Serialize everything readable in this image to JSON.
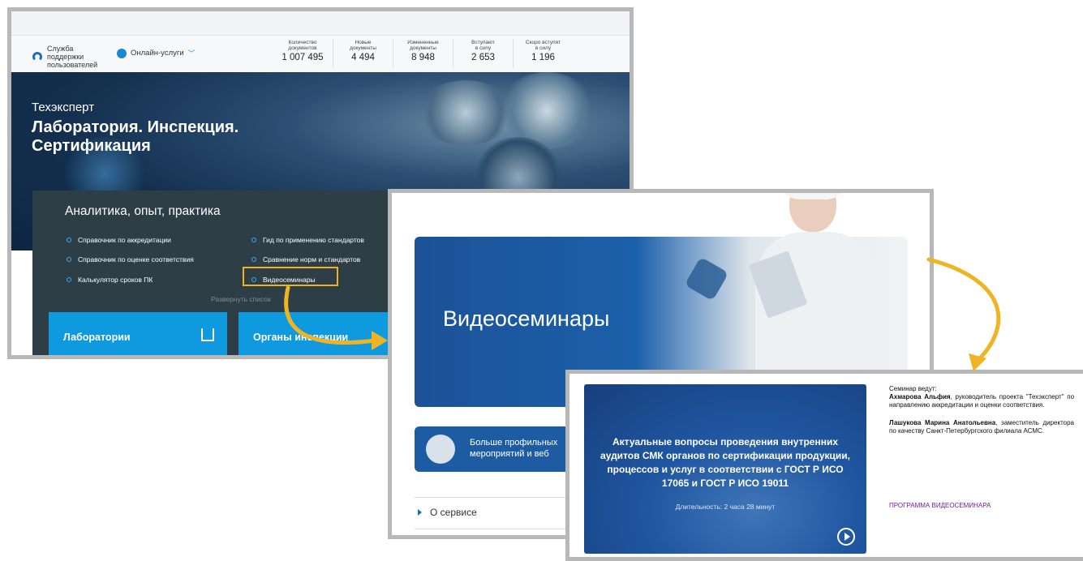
{
  "site": {
    "support_label": "Служба поддержки пользователей",
    "online_label": "Онлайн-услуги",
    "stats": [
      {
        "label": "Количество\nдокументов",
        "value": "1 007 495"
      },
      {
        "label": "Новые\nдокументы",
        "value": "4 494"
      },
      {
        "label": "Измененные\nдокументы",
        "value": "8 948"
      },
      {
        "label": "Вступают\nв силу",
        "value": "2 653"
      },
      {
        "label": "Скоро вступят\nв силу",
        "value": "1 196"
      }
    ],
    "hero": {
      "subtitle": "Техэксперт",
      "title": "Лаборатория. Инспекция. Сертификация"
    },
    "analytics": {
      "title": "Аналитика, опыт, практика",
      "links_left": [
        "Справочник по аккредитации",
        "Справочник по оценке соответствия",
        "Калькулятор сроков ПК"
      ],
      "links_right": [
        "Гид по применению стандартов",
        "Сравнение норм и стандартов",
        "Видеосеминары"
      ],
      "expand_label": "Развернуть список"
    },
    "cards": {
      "lab": "Лаборатории",
      "inspection": "Органы инспекции"
    }
  },
  "videos_page": {
    "banner_title": "Видеосеминары",
    "promo_line1": "Больше профильных",
    "promo_line2": "мероприятий и веб",
    "about_label": "О сервисе"
  },
  "seminar": {
    "title": "Актуальные вопросы проведения внутренних аудитов СМК органов по сертификации продукции, процессов и услуг в соответствии с ГОСТ Р ИСО 17065 и ГОСТ Р ИСО 19011",
    "duration": "Длительность: 2 часа 28 минут",
    "hosts_heading": "Семинар ведут:",
    "host1_name": "Ахмарова Альфия",
    "host1_role": ", руководитель проекта \"Техэксперт\" по направлению аккредитации и оценки соответствия.",
    "host2_name": "Лашукова Марина Анатольевна",
    "host2_role": ", заместитель директора по качеству Санкт-Петербургского филиала АСМС.",
    "program_link": "ПРОГРАММА ВИДЕОСЕМИНАРА"
  },
  "colors": {
    "highlight": "#f0b323",
    "accent": "#0f9ae0",
    "dark_panel": "#2d3e47",
    "link_purple": "#6a1fa0"
  }
}
